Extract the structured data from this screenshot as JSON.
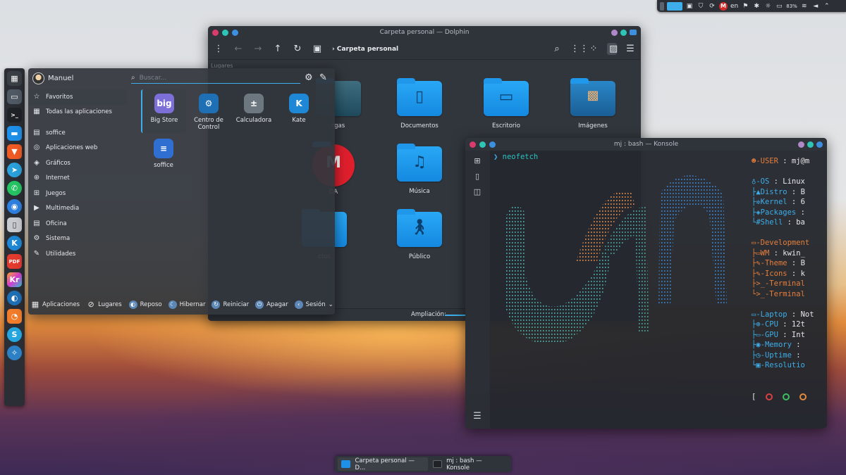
{
  "tray": {
    "lang": "en",
    "battery": "83%"
  },
  "dock": {
    "items": [
      "overview",
      "desktop",
      "terminal",
      "dolphin",
      "brave",
      "telegram",
      "whatsapp",
      "thunderbird",
      "files",
      "kate",
      "pdf",
      "krita",
      "steam",
      "firefox-dev",
      "skype",
      "system"
    ]
  },
  "dolphin": {
    "title": "Carpeta personal — Dolphin",
    "breadcrumb": "Carpeta personal",
    "places_label": "Lugares",
    "zoom_label": "Ampliación:",
    "items": [
      {
        "label": "rgas",
        "icon": "downloads"
      },
      {
        "label": "Documentos",
        "icon": "document"
      },
      {
        "label": "Escritorio",
        "icon": "desktop"
      },
      {
        "label": "Imágenes",
        "icon": "pictures"
      },
      {
        "label": "GA",
        "icon": "mega"
      },
      {
        "label": "Música",
        "icon": "music"
      },
      {
        "label": "ctos",
        "icon": "projects"
      },
      {
        "label": "Público",
        "icon": "public"
      }
    ]
  },
  "konsole": {
    "title": "mj : bash — Konsole",
    "prompt_symbol": "❯",
    "command": "neofetch",
    "lines": [
      {
        "icon": "☻",
        "key": "-USER",
        "val": ": mj@m",
        "k": "r"
      },
      {
        "icon": "",
        "key": "",
        "val": "",
        "k": "r"
      },
      {
        "icon": "♁",
        "key": "-OS",
        "val": ": Linux",
        "k": "b"
      },
      {
        "icon": "├▲",
        "key": "Distro",
        "val": ": B",
        "k": "b"
      },
      {
        "icon": "├✲",
        "key": "Kernel",
        "val": ": 6",
        "k": "b"
      },
      {
        "icon": "├◈",
        "key": "Packages",
        "val": ":",
        "k": "b"
      },
      {
        "icon": "└#",
        "key": "Shell",
        "val": ": ba",
        "k": "b"
      },
      {
        "icon": "",
        "key": "",
        "val": "",
        "k": "r"
      },
      {
        "icon": "▭",
        "key": "-Development",
        "val": "",
        "k": "r"
      },
      {
        "icon": "├▭",
        "key": "WM",
        "val": ": kwin_",
        "k": "r"
      },
      {
        "icon": "├✎",
        "key": "-Theme",
        "val": ": B",
        "k": "r"
      },
      {
        "icon": "├✎",
        "key": "-Icons",
        "val": ": k",
        "k": "r"
      },
      {
        "icon": "├>_",
        "key": "-Terminal",
        "val": "",
        "k": "r"
      },
      {
        "icon": "└>_",
        "key": "-Terminal",
        "val": "",
        "k": "r"
      },
      {
        "icon": "",
        "key": "",
        "val": "",
        "k": "r"
      },
      {
        "icon": "▭",
        "key": "-Laptop",
        "val": ": Not",
        "k": "b"
      },
      {
        "icon": "├⊕",
        "key": "-CPU",
        "val": ": 12t",
        "k": "b"
      },
      {
        "icon": "├▭",
        "key": "-GPU",
        "val": ": Int",
        "k": "b"
      },
      {
        "icon": "├◉",
        "key": "-Memory",
        "val": ":",
        "k": "b"
      },
      {
        "icon": "├◷",
        "key": "-Uptime",
        "val": ":",
        "k": "b"
      },
      {
        "icon": "└▣",
        "key": "-Resolutio",
        "val": "",
        "k": "b"
      }
    ],
    "bracket": "["
  },
  "launcher": {
    "user": "Manuel",
    "search_placeholder": "Buscar...",
    "categories": [
      {
        "label": "Favoritos",
        "icon": "☆",
        "sel": true
      },
      {
        "label": "Todas las aplicaciones",
        "icon": "▦"
      },
      {
        "label": "soffice",
        "icon": "▤",
        "sep_before": true
      },
      {
        "label": "Aplicaciones web",
        "icon": "◎"
      },
      {
        "label": "Gráficos",
        "icon": "◈"
      },
      {
        "label": "Internet",
        "icon": "⊕"
      },
      {
        "label": "Juegos",
        "icon": "⊞"
      },
      {
        "label": "Multimedia",
        "icon": "▶"
      },
      {
        "label": "Oficina",
        "icon": "▤"
      },
      {
        "label": "Sistema",
        "icon": "⚙"
      },
      {
        "label": "Utilidades",
        "icon": "✎"
      }
    ],
    "apps": [
      {
        "label": "Big Store",
        "icon_text": "big",
        "color": "#7d6fd8",
        "sel": true
      },
      {
        "label": "Centro de Control",
        "icon_text": "⚙",
        "color": "#1f6fb5"
      },
      {
        "label": "Calculadora",
        "icon_text": "±",
        "color": "#6d7780"
      },
      {
        "label": "Kate",
        "icon_text": "K",
        "color": "#1e88d6"
      },
      {
        "label": "soffice",
        "icon_text": "≡",
        "color": "#2f6fd1"
      }
    ],
    "footer": {
      "apps": "Aplicaciones",
      "places": "Lugares",
      "reposo": "Reposo",
      "hibernar": "Hibernar",
      "reiniciar": "Reiniciar",
      "apagar": "Apagar",
      "sesion": "Sesión"
    }
  },
  "taskbar": {
    "tasks": [
      "Carpeta personal — D...",
      "mj : bash — Konsole"
    ]
  }
}
